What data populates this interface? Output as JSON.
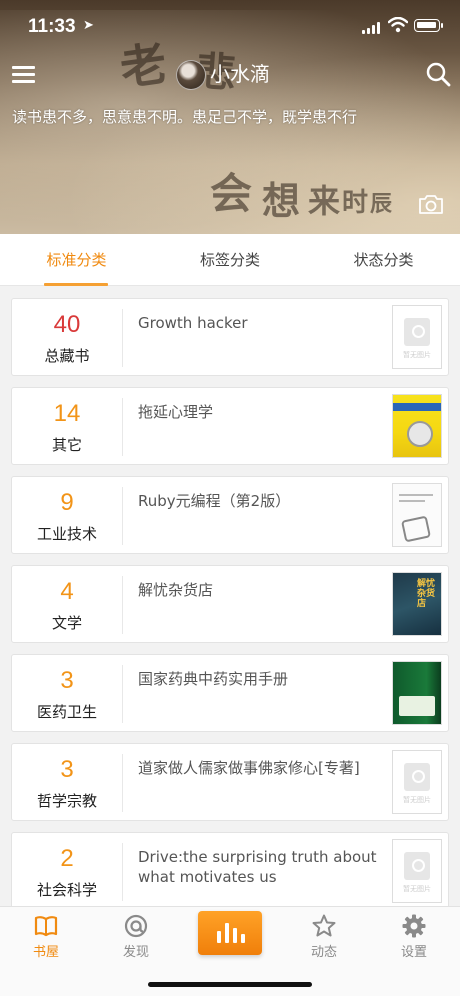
{
  "status_bar": {
    "time": "11:33"
  },
  "header": {
    "username": "小水滴",
    "motto": "读书患不多，思意患不明。患足己不学，既学患不行",
    "background_calligraphy": [
      "老",
      "悲",
      "会",
      "想",
      "来",
      "时",
      "辰"
    ]
  },
  "tabs": [
    {
      "label": "标准分类",
      "active": true
    },
    {
      "label": "标签分类",
      "active": false
    },
    {
      "label": "状态分类",
      "active": false
    }
  ],
  "categories": [
    {
      "count": "40",
      "name": "总藏书",
      "book": "Growth hacker",
      "cover": "placeholder",
      "count_color": "#d93a3a"
    },
    {
      "count": "14",
      "name": "其它",
      "book": "拖延心理学",
      "cover": "yellow"
    },
    {
      "count": "9",
      "name": "工业技术",
      "book": "Ruby元编程（第2版）",
      "cover": "white"
    },
    {
      "count": "4",
      "name": "文学",
      "book": "解忧杂货店",
      "cover": "dark"
    },
    {
      "count": "3",
      "name": "医药卫生",
      "book": "国家药典中药实用手册",
      "cover": "green"
    },
    {
      "count": "3",
      "name": "哲学宗教",
      "book": "道家做人儒家做事佛家修心[专著]",
      "cover": "placeholder"
    },
    {
      "count": "2",
      "name": "社会科学",
      "book": "Drive:the surprising truth about what motivates us",
      "cover": "placeholder"
    }
  ],
  "cover_placeholder_text": "暂无图片",
  "cover_titles": {
    "dark": "解忧杂货店"
  },
  "bottom_nav": [
    {
      "label": "书屋",
      "icon": "book-icon",
      "active": true
    },
    {
      "label": "发现",
      "icon": "discover-icon",
      "active": false
    },
    {
      "label": "",
      "icon": "bar-chart-icon",
      "active": false
    },
    {
      "label": "动态",
      "icon": "star-icon",
      "active": false
    },
    {
      "label": "设置",
      "icon": "gear-icon",
      "active": false
    }
  ],
  "colors": {
    "accent": "#f08a10",
    "total_count": "#d93a3a",
    "count": "#f29418"
  }
}
